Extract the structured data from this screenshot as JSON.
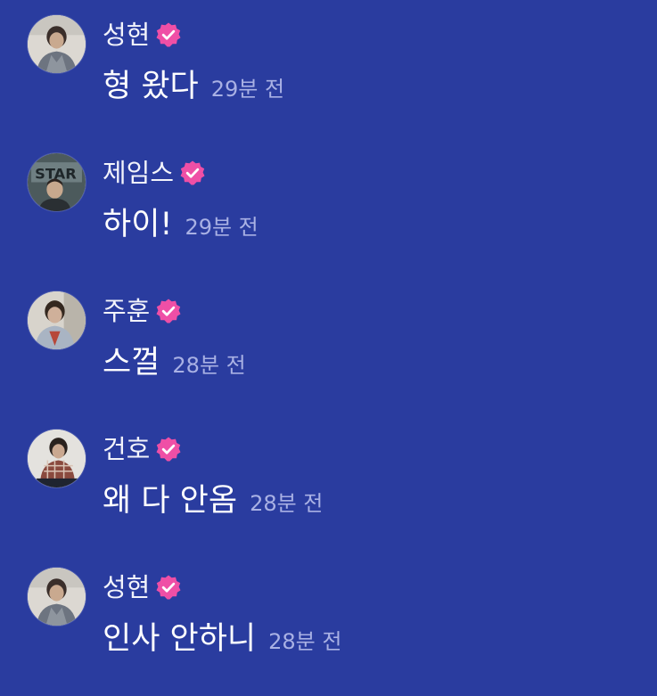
{
  "colors": {
    "background": "#2a3c9f",
    "name_text": "#f2f3fb",
    "message_text": "#ffffff",
    "timestamp_text": "#a9b1e4",
    "verified_badge": "#ef4fa6"
  },
  "messages": [
    {
      "name": "성현",
      "verified_icon": "verified-badge-icon",
      "text": "형 왔다",
      "time": "29분 전"
    },
    {
      "name": "제임스",
      "verified_icon": "verified-badge-icon",
      "text": "하이!",
      "time": "29분 전"
    },
    {
      "name": "주훈",
      "verified_icon": "verified-badge-icon",
      "text": "스껄",
      "time": "28분 전"
    },
    {
      "name": "건호",
      "verified_icon": "verified-badge-icon",
      "text": "왜 다 안옴",
      "time": "28분 전"
    },
    {
      "name": "성현",
      "verified_icon": "verified-badge-icon",
      "text": "인사 안하니",
      "time": "28분 전"
    }
  ]
}
